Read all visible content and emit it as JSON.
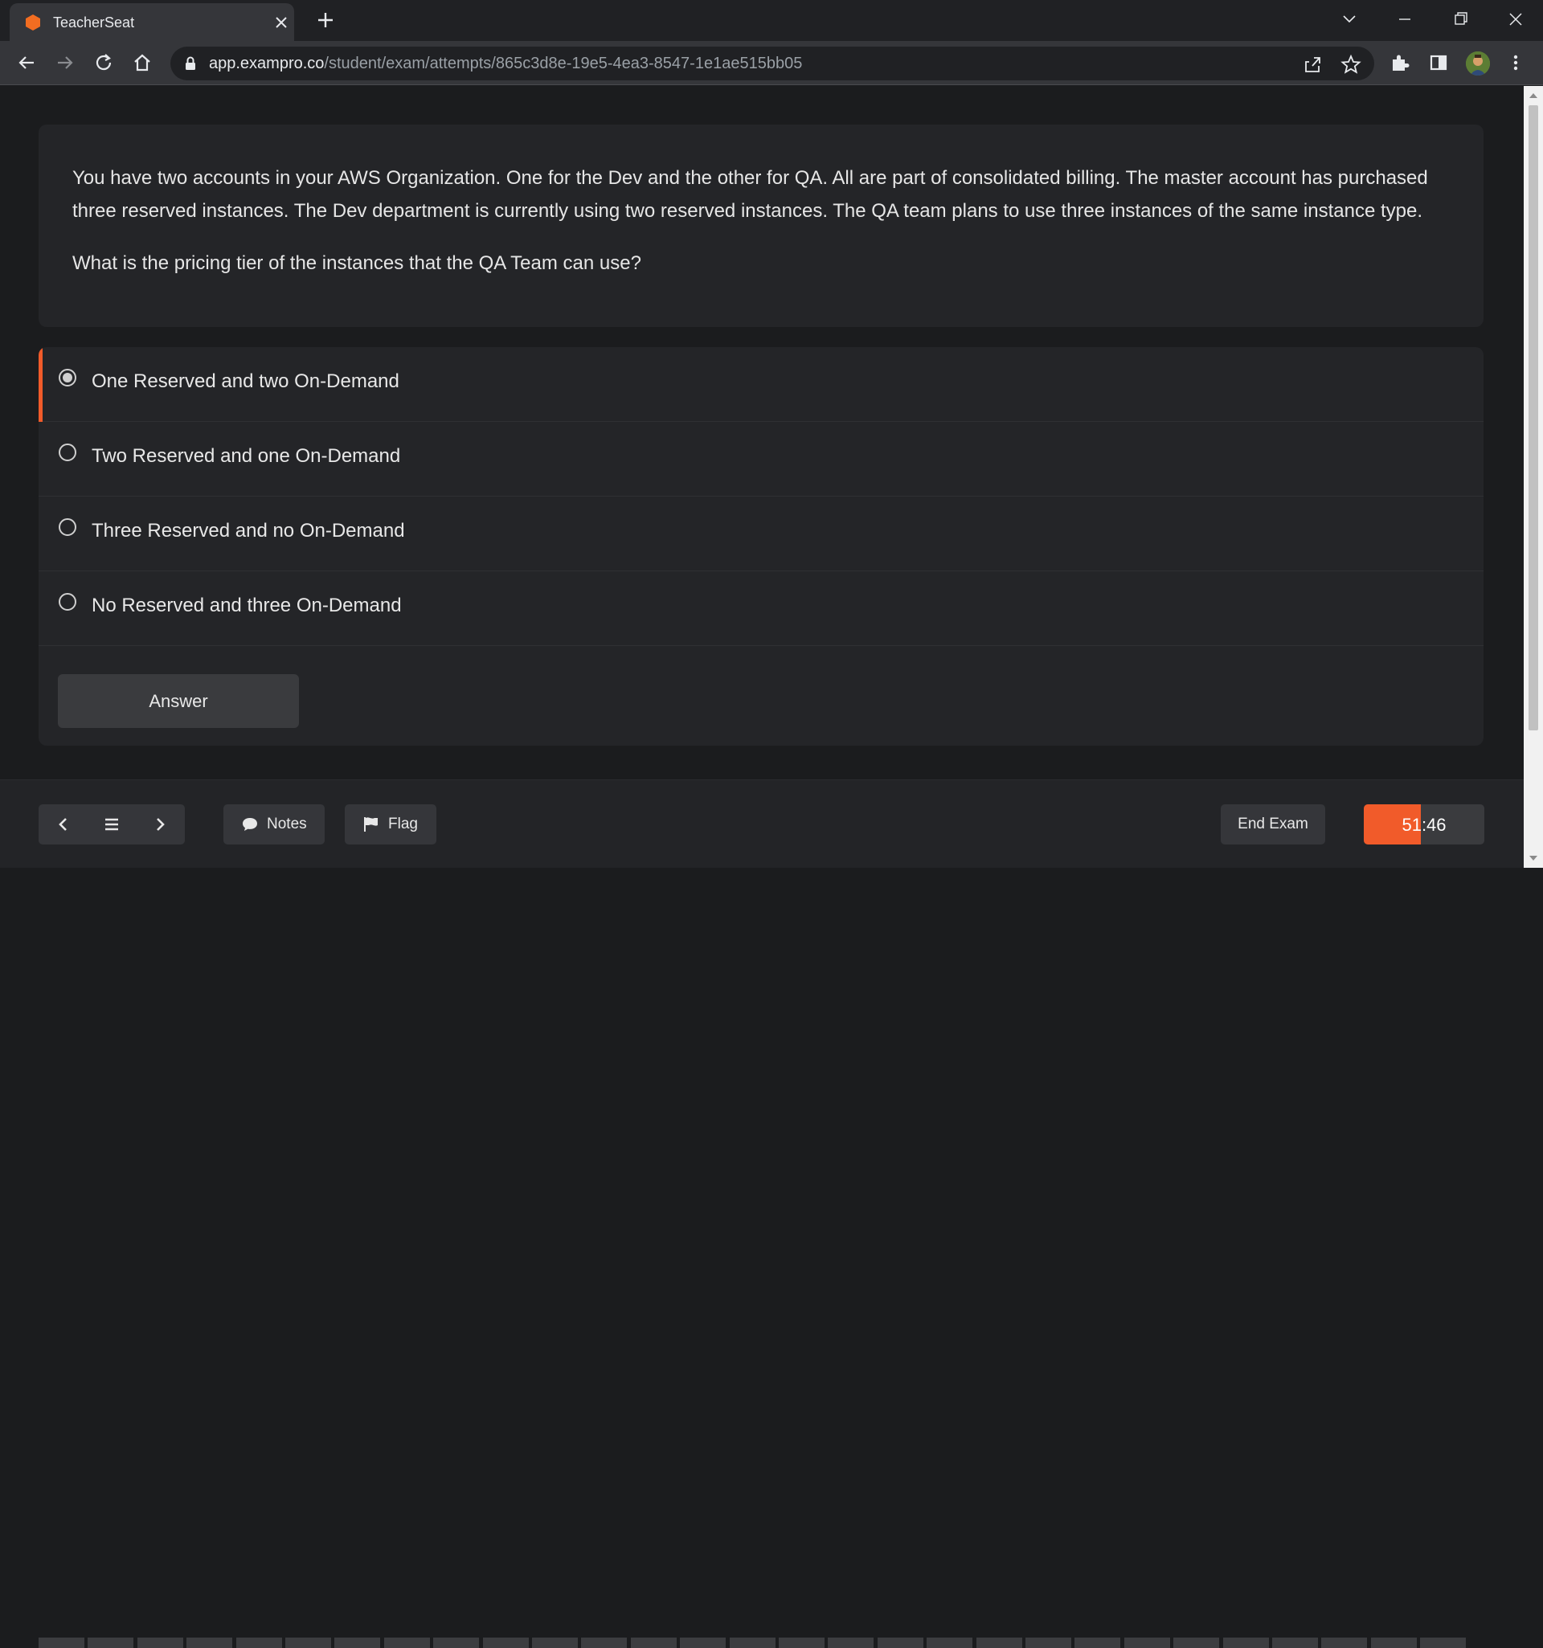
{
  "browser": {
    "tab_title": "TeacherSeat",
    "url_host": "app.exampro.co",
    "url_path": "/student/exam/attempts/865c3d8e-19e5-4ea3-8547-1e1ae515bb05",
    "icons": [
      "hexagon-favicon-icon",
      "close-icon",
      "plus-icon",
      "chevron-down-icon",
      "minimize-icon",
      "restore-icon",
      "window-close-icon",
      "back-arrow-icon",
      "forward-arrow-icon",
      "reload-icon",
      "home-icon",
      "lock-icon",
      "share-icon",
      "star-icon",
      "puzzle-icon",
      "sidepanel-icon",
      "avatar",
      "kebab-menu-icon"
    ]
  },
  "question": {
    "text": "You have two accounts in your AWS Organization. One for the Dev and the other for QA. All are part of consolidated billing. The master account has purchased three reserved instances. The Dev department is currently using two reserved instances. The QA team plans to use three instances of the same instance type.",
    "prompt": "What is the pricing tier of the instances that the QA Team can use?"
  },
  "options": [
    {
      "label": "One Reserved and two On-Demand",
      "selected": true
    },
    {
      "label": "Two Reserved and one On-Demand",
      "selected": false
    },
    {
      "label": "Three Reserved and no On-Demand",
      "selected": false
    },
    {
      "label": "No Reserved and three On-Demand",
      "selected": false
    }
  ],
  "answer_button": "Answer",
  "footer": {
    "notes_label": "Notes",
    "flag_label": "Flag",
    "end_exam_label": "End Exam",
    "timer": "51:46",
    "timer_elapsed_fraction": 0.47
  },
  "colors": {
    "accent": "#f15b2a",
    "page_bg": "#1b1c1e",
    "card_bg": "#242528"
  }
}
